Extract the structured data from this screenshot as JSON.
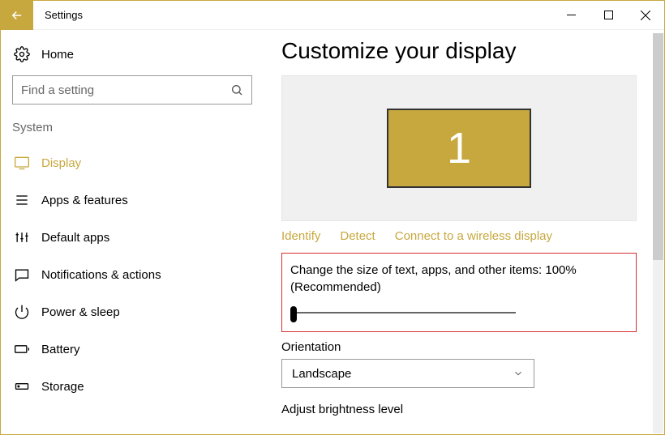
{
  "window": {
    "title": "Settings"
  },
  "sidebar": {
    "home": "Home",
    "search_placeholder": "Find a setting",
    "section": "System",
    "items": [
      {
        "label": "Display"
      },
      {
        "label": "Apps & features"
      },
      {
        "label": "Default apps"
      },
      {
        "label": "Notifications & actions"
      },
      {
        "label": "Power & sleep"
      },
      {
        "label": "Battery"
      },
      {
        "label": "Storage"
      }
    ]
  },
  "main": {
    "heading": "Customize your display",
    "monitor_number": "1",
    "links": {
      "identify": "Identify",
      "detect": "Detect",
      "wireless": "Connect to a wireless display"
    },
    "scale_text": "Change the size of text, apps, and other items: 100% (Recommended)",
    "orientation_label": "Orientation",
    "orientation_value": "Landscape",
    "brightness_label": "Adjust brightness level"
  }
}
